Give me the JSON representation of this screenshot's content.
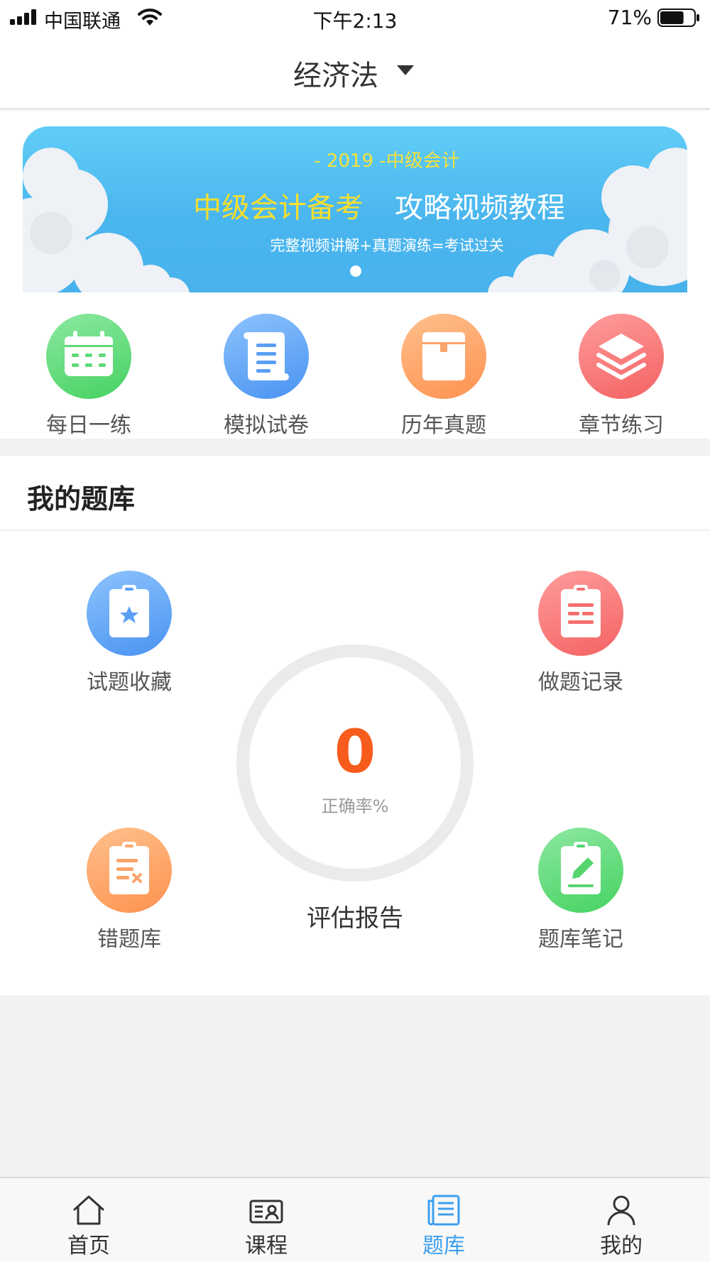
{
  "status_bar": {
    "carrier": "中国联通",
    "time": "下午2:13",
    "battery_percent": "71%",
    "battery_level": 0.71
  },
  "header": {
    "subject": "经济法"
  },
  "banner": {
    "year_line": "- 2019 -中级会计",
    "title_highlight": "中级会计备考",
    "title_main": "攻略视频教程",
    "subtitle": "完整视频讲解+真题演练=考试过关",
    "colors": {
      "background": "#4ab6ee",
      "highlight": "#f5df2e"
    }
  },
  "quick_nav": [
    {
      "label": "每日一练",
      "icon": "calendar-icon",
      "color": "#4fd56c"
    },
    {
      "label": "模拟试卷",
      "icon": "scroll-document-icon",
      "color": "#4f9cf5"
    },
    {
      "label": "历年真题",
      "icon": "archive-box-icon",
      "color": "#fd9a5b"
    },
    {
      "label": "章节练习",
      "icon": "layers-icon",
      "color": "#f76a6a"
    }
  ],
  "my_bank": {
    "title": "我的题库",
    "items": {
      "favorites": {
        "label": "试题收藏",
        "icon": "clipboard-star-icon",
        "color": "#4f9cf5"
      },
      "records": {
        "label": "做题记录",
        "icon": "clipboard-list-icon",
        "color": "#f76a6a"
      },
      "mistakes": {
        "label": "错题库",
        "icon": "clipboard-cross-icon",
        "color": "#fd9a5b"
      },
      "notes": {
        "label": "题库笔记",
        "icon": "clipboard-edit-icon",
        "color": "#4fd56c"
      }
    },
    "accuracy": {
      "value": "0",
      "caption": "正确率%",
      "color": "#f75c1c"
    },
    "report_label": "评估报告"
  },
  "tabbar": {
    "items": [
      {
        "label": "首页",
        "icon": "home-icon",
        "active": false
      },
      {
        "label": "课程",
        "icon": "course-card-icon",
        "active": false
      },
      {
        "label": "题库",
        "icon": "question-bank-icon",
        "active": true
      },
      {
        "label": "我的",
        "icon": "profile-icon",
        "active": false
      }
    ],
    "active_color": "#3b9ff0"
  }
}
